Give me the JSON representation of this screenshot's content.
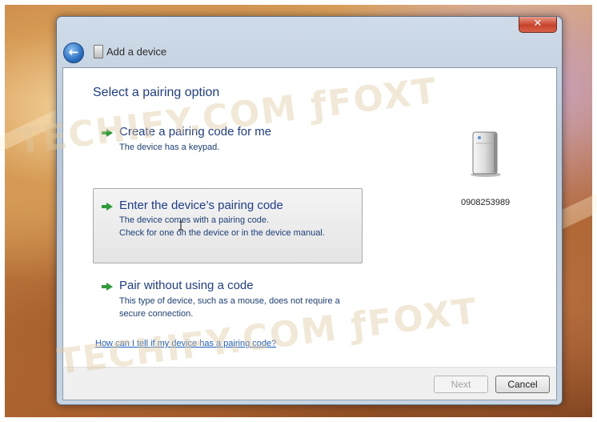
{
  "window": {
    "title": "Add a device",
    "close_label": "✕"
  },
  "main": {
    "heading": "Select a pairing option",
    "options": [
      {
        "title": "Create a pairing code for me",
        "description": [
          "The device has a keypad."
        ],
        "selected": false
      },
      {
        "title": "Enter the device’s pairing code",
        "description": [
          "The device comes with a pairing code.",
          "Check for one on the device or in the device manual."
        ],
        "selected": true
      },
      {
        "title": "Pair without using a code",
        "description": [
          "This type of device, such as a mouse, does not require a",
          "secure connection."
        ],
        "selected": false
      }
    ],
    "device": {
      "name": "0908253989",
      "icon": "device-tower-icon"
    },
    "help_link": "How can I tell if my device has a pairing code?"
  },
  "footer": {
    "next_label": "Next",
    "next_enabled": false,
    "cancel_label": "Cancel"
  },
  "watermarks": {
    "text_upper": "TECHIFY.COM ƒFOXT",
    "text_lower": "TECHIFY.COM ƒFOXT"
  },
  "colors": {
    "heading": "#1e3d8a",
    "option_arrow": "#2e9b3a",
    "link": "#1f5fbf",
    "close_button": "#c7422a"
  }
}
